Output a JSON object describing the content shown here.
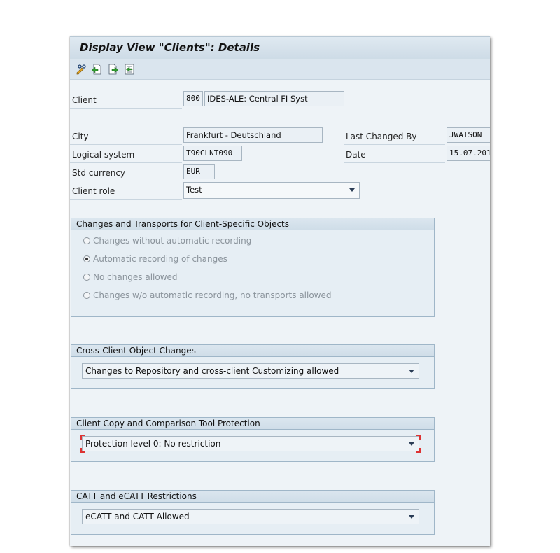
{
  "window": {
    "title": "Display View \"Clients\": Details"
  },
  "toolbar": {
    "icons": [
      "display-change-icon",
      "previous-entry-icon",
      "next-entry-icon",
      "select-block-icon"
    ]
  },
  "fields": {
    "client": {
      "label": "Client",
      "number": "800",
      "name": "IDES-ALE: Central FI Syst"
    },
    "city": {
      "label": "City",
      "value": "Frankfurt - Deutschland"
    },
    "logical_system": {
      "label": "Logical system",
      "value": "T90CLNT090"
    },
    "std_currency": {
      "label": "Std currency",
      "value": "EUR"
    },
    "client_role": {
      "label": "Client role",
      "value": "Test"
    },
    "last_changed_by": {
      "label": "Last Changed By",
      "value": "JWATSON"
    },
    "date": {
      "label": "Date",
      "value": "15.07.201"
    }
  },
  "changes_transports": {
    "title": "Changes and Transports for Client-Specific Objects",
    "options": [
      {
        "label": "Changes without automatic recording",
        "selected": false
      },
      {
        "label": "Automatic recording of changes",
        "selected": true
      },
      {
        "label": "No changes allowed",
        "selected": false
      },
      {
        "label": "Changes w/o automatic recording, no transports allowed",
        "selected": false
      }
    ]
  },
  "cross_client": {
    "title": "Cross-Client Object Changes",
    "value": "Changes to Repository and cross-client Customizing allowed"
  },
  "copy_protection": {
    "title": "Client Copy and Comparison Tool Protection",
    "value": "Protection level 0: No restriction"
  },
  "catt": {
    "title": "CATT and eCATT Restrictions",
    "value": "eCATT and CATT Allowed"
  },
  "colors": {
    "frame_bg": "#eef3f7",
    "title_bg": "#d4e0ea",
    "focus_red": "#dd3333"
  }
}
